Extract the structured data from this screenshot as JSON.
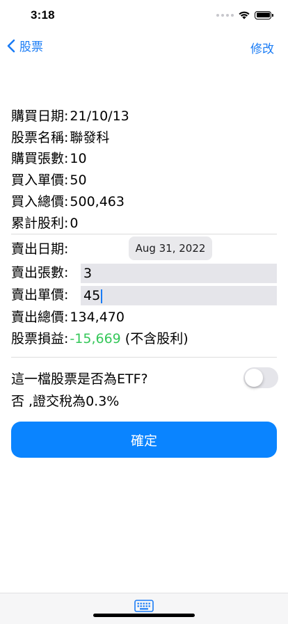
{
  "status_bar": {
    "time": "3:18"
  },
  "nav": {
    "back_label": "股票",
    "edit_label": "修改",
    "accent_color": "#1a7cf5"
  },
  "purchase": {
    "date_label": "購買日期:",
    "date_value": "21/10/13",
    "name_label": "股票名稱:",
    "name_value": "聯發科",
    "quantity_label": "購買張數:",
    "quantity_value": "10",
    "unit_price_label": "買入單價:",
    "unit_price_value": "50",
    "total_label": "買入總價:",
    "total_value": "500,463",
    "dividend_label": "累計股利:",
    "dividend_value": "0"
  },
  "sale": {
    "date_label": "賣出日期:",
    "date_value": "Aug 31, 2022",
    "quantity_label": "賣出張數:",
    "quantity_value": "3",
    "unit_price_label": "賣出單價:",
    "unit_price_value": "45",
    "total_label": "賣出總價:",
    "total_value": "134,470",
    "profit_label": "股票損益:",
    "profit_value": "-15,669",
    "profit_note": "(不含股利)",
    "profit_color": "#34c759"
  },
  "etf": {
    "question": "這一檔股票是否為ETF?",
    "toggle_on": false,
    "tax_note": "否 ,證交稅為0.3%"
  },
  "confirm_label": "確定",
  "bottom_bar": {
    "icon": "keyboard-icon"
  }
}
